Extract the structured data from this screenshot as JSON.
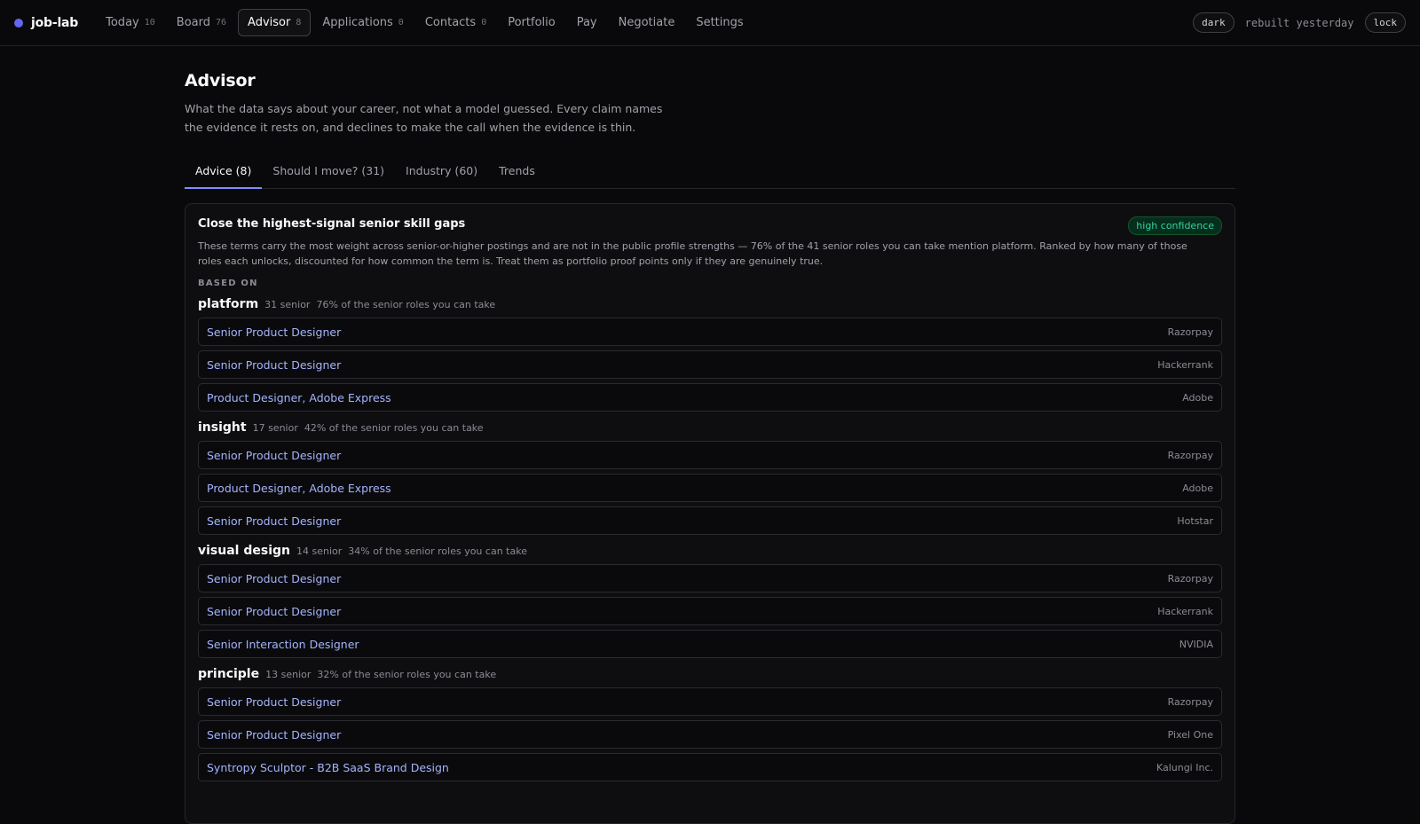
{
  "brand": {
    "name": "job-lab",
    "accent": "#6366f1"
  },
  "nav": [
    {
      "label": "Today",
      "count": "10"
    },
    {
      "label": "Board",
      "count": "76"
    },
    {
      "label": "Advisor",
      "count": "8",
      "active": true
    },
    {
      "label": "Applications",
      "count": "0"
    },
    {
      "label": "Contacts",
      "count": "0"
    },
    {
      "label": "Portfolio"
    },
    {
      "label": "Pay"
    },
    {
      "label": "Negotiate"
    },
    {
      "label": "Settings"
    }
  ],
  "topbar_right": {
    "theme_label": "dark",
    "rebuilt_text": "rebuilt yesterday",
    "lock_label": "lock"
  },
  "page": {
    "title": "Advisor",
    "subtitle": "What the data says about your career, not what a model guessed. Every claim names the evidence it rests on, and declines to make the call when the evidence is thin."
  },
  "tabs": [
    {
      "label": "Advice (8)",
      "active": true
    },
    {
      "label": "Should I move? (31)"
    },
    {
      "label": "Industry (60)"
    },
    {
      "label": "Trends"
    }
  ],
  "card": {
    "title": "Close the highest-signal senior skill gaps",
    "confidence": "high confidence",
    "description": "These terms carry the most weight across senior-or-higher postings and are not in the public profile strengths — 76% of the 41 senior roles you can take mention platform. Ranked by how many of those roles each unlocks, discounted for how common the term is. Treat them as portfolio proof points only if they are genuinely true.",
    "based_on_label": "BASED ON",
    "groups": [
      {
        "term": "platform",
        "count": "31 senior",
        "share": "76% of the senior roles you can take",
        "roles": [
          {
            "title": "Senior Product Designer",
            "company": "Razorpay"
          },
          {
            "title": "Senior Product Designer",
            "company": "Hackerrank"
          },
          {
            "title": "Product Designer, Adobe Express",
            "company": "Adobe"
          }
        ]
      },
      {
        "term": "insight",
        "count": "17 senior",
        "share": "42% of the senior roles you can take",
        "roles": [
          {
            "title": "Senior Product Designer",
            "company": "Razorpay"
          },
          {
            "title": "Product Designer, Adobe Express",
            "company": "Adobe"
          },
          {
            "title": "Senior Product Designer",
            "company": "Hotstar"
          }
        ]
      },
      {
        "term": "visual design",
        "count": "14 senior",
        "share": "34% of the senior roles you can take",
        "roles": [
          {
            "title": "Senior Product Designer",
            "company": "Razorpay"
          },
          {
            "title": "Senior Product Designer",
            "company": "Hackerrank"
          },
          {
            "title": "Senior Interaction Designer",
            "company": "NVIDIA"
          }
        ]
      },
      {
        "term": "principle",
        "count": "13 senior",
        "share": "32% of the senior roles you can take",
        "roles": [
          {
            "title": "Senior Product Designer",
            "company": "Razorpay"
          },
          {
            "title": "Senior Product Designer",
            "company": "Pixel One"
          },
          {
            "title": "Syntropy Sculptor - B2B SaaS Brand Design",
            "company": "Kalungi Inc."
          }
        ]
      }
    ]
  }
}
